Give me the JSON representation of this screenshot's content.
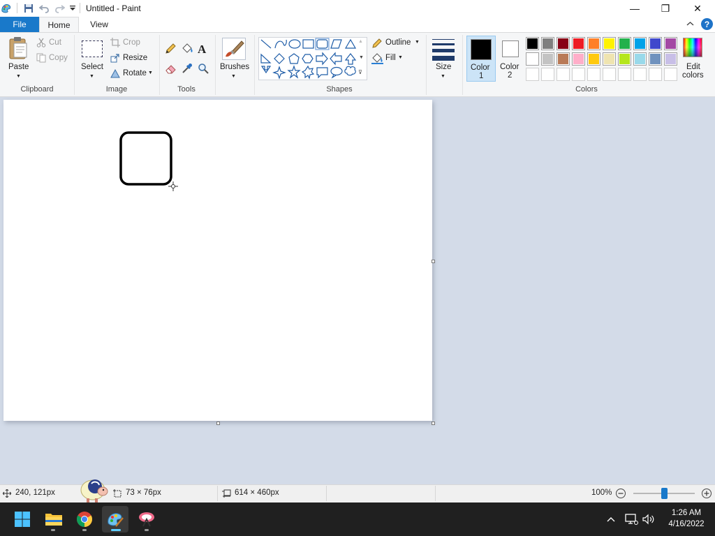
{
  "window": {
    "title": "Untitled - Paint",
    "controls": {
      "minimize": "—",
      "maximize": "❐",
      "close": "✕"
    }
  },
  "tabs": {
    "file": "File",
    "home": "Home",
    "view": "View"
  },
  "help": "?",
  "clipboard": {
    "group": "Clipboard",
    "paste": "Paste",
    "cut": "Cut",
    "copy": "Copy"
  },
  "image": {
    "group": "Image",
    "select": "Select",
    "crop": "Crop",
    "resize": "Resize",
    "rotate": "Rotate"
  },
  "tools": {
    "group": "Tools"
  },
  "brushes": {
    "label": "Brushes"
  },
  "shapes": {
    "group": "Shapes",
    "outline": "Outline",
    "fill": "Fill"
  },
  "size": {
    "label": "Size"
  },
  "colors": {
    "group": "Colors",
    "color1_line1": "Color",
    "color1_line2": "1",
    "color2_line1": "Color",
    "color2_line2": "2",
    "edit_line1": "Edit",
    "edit_line2": "colors",
    "color1_value": "#000000",
    "color2_value": "#ffffff",
    "palette_row1": [
      "#000000",
      "#7f7f7f",
      "#880015",
      "#ed1c24",
      "#ff7f27",
      "#fff200",
      "#22b14c",
      "#00a2e8",
      "#3f48cc",
      "#a349a4"
    ],
    "palette_row2": [
      "#ffffff",
      "#c3c3c3",
      "#b97a57",
      "#ffaec9",
      "#ffc90e",
      "#efe4b0",
      "#b5e61d",
      "#99d9ea",
      "#7092be",
      "#c8bfe7"
    ],
    "palette_row3": [
      "#ffffff",
      "#ffffff",
      "#ffffff",
      "#ffffff",
      "#ffffff",
      "#ffffff",
      "#ffffff",
      "#ffffff",
      "#ffffff",
      "#ffffff"
    ]
  },
  "status": {
    "cursor_pos": "240, 121px",
    "selection_size": "73 × 76px",
    "image_size": "614 × 460px",
    "zoom": "100%",
    "zoom_fraction": 0.5
  },
  "taskbar": {
    "time": "1:26 AM",
    "date": "4/16/2022"
  },
  "accent": "#1979ca"
}
